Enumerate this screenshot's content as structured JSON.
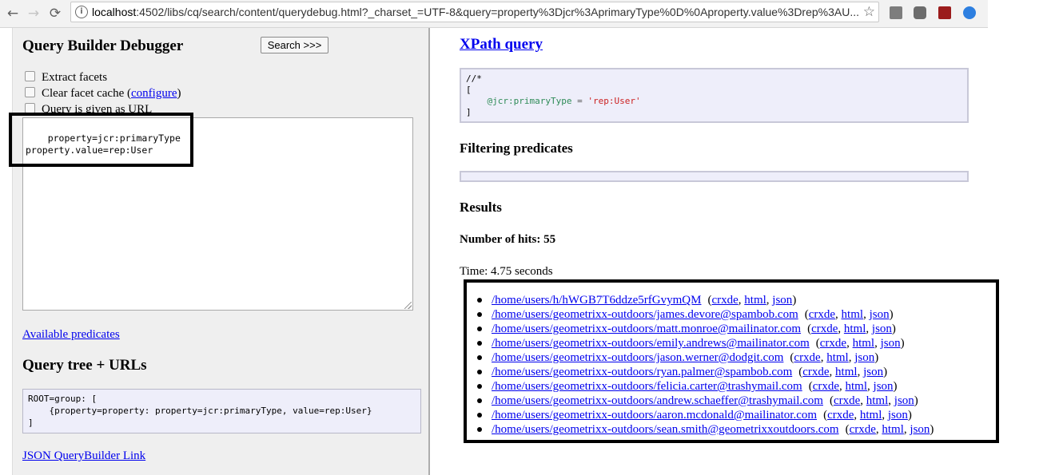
{
  "browser": {
    "back_glyph": "←",
    "forward_glyph": "→",
    "reload_glyph": "⟳",
    "info_glyph": "i",
    "url_host": "localhost",
    "url_rest": ":4502/libs/cq/search/content/querydebug.html?_charset_=UTF-8&query=property%3Djcr%3AprimaryType%0D%0Aproperty.value%3Drep%3AU...",
    "star_glyph": "☆"
  },
  "left": {
    "title": "Query Builder Debugger",
    "search_button": "Search >>>",
    "extract_facets": "Extract facets",
    "clear_cache_prefix": "Clear facet cache (",
    "configure_link": "configure",
    "clear_cache_suffix": ")",
    "query_given_as_url": "Query is given as URL",
    "query_text": "property=jcr:primaryType\nproperty.value=rep:User",
    "available_predicates": "Available predicates",
    "query_tree_title": "Query tree + URLs",
    "query_tree_text": "ROOT=group: [\n    {property=property: property=jcr:primaryType, value=rep:User}\n]",
    "json_link": "JSON QueryBuilder Link"
  },
  "right": {
    "xpath_title": "XPath query",
    "xpath_line1": "//*",
    "xpath_line2": "[",
    "xpath_attr": "@jcr:primaryType",
    "xpath_op": " = ",
    "xpath_value": "'rep:User'",
    "xpath_line4": "]",
    "filtering_title": "Filtering predicates",
    "results_title": "Results",
    "hits": "Number of hits: 55",
    "time": "Time: 4.75 seconds",
    "extra_open": "(",
    "crxde": "crxde",
    "html": "html",
    "json": "json",
    "extra_sep": ", ",
    "extra_close": ")",
    "results": [
      "/home/users/h/hWGB7T6ddze5rfGvymQM",
      "/home/users/geometrixx-outdoors/james.devore@spambob.com",
      "/home/users/geometrixx-outdoors/matt.monroe@mailinator.com",
      "/home/users/geometrixx-outdoors/emily.andrews@mailinator.com",
      "/home/users/geometrixx-outdoors/jason.werner@dodgit.com",
      "/home/users/geometrixx-outdoors/ryan.palmer@spambob.com",
      "/home/users/geometrixx-outdoors/felicia.carter@trashymail.com",
      "/home/users/geometrixx-outdoors/andrew.schaeffer@trashymail.com",
      "/home/users/geometrixx-outdoors/aaron.mcdonald@mailinator.com",
      "/home/users/geometrixx-outdoors/sean.smith@geometrixxoutdoors.com"
    ]
  }
}
